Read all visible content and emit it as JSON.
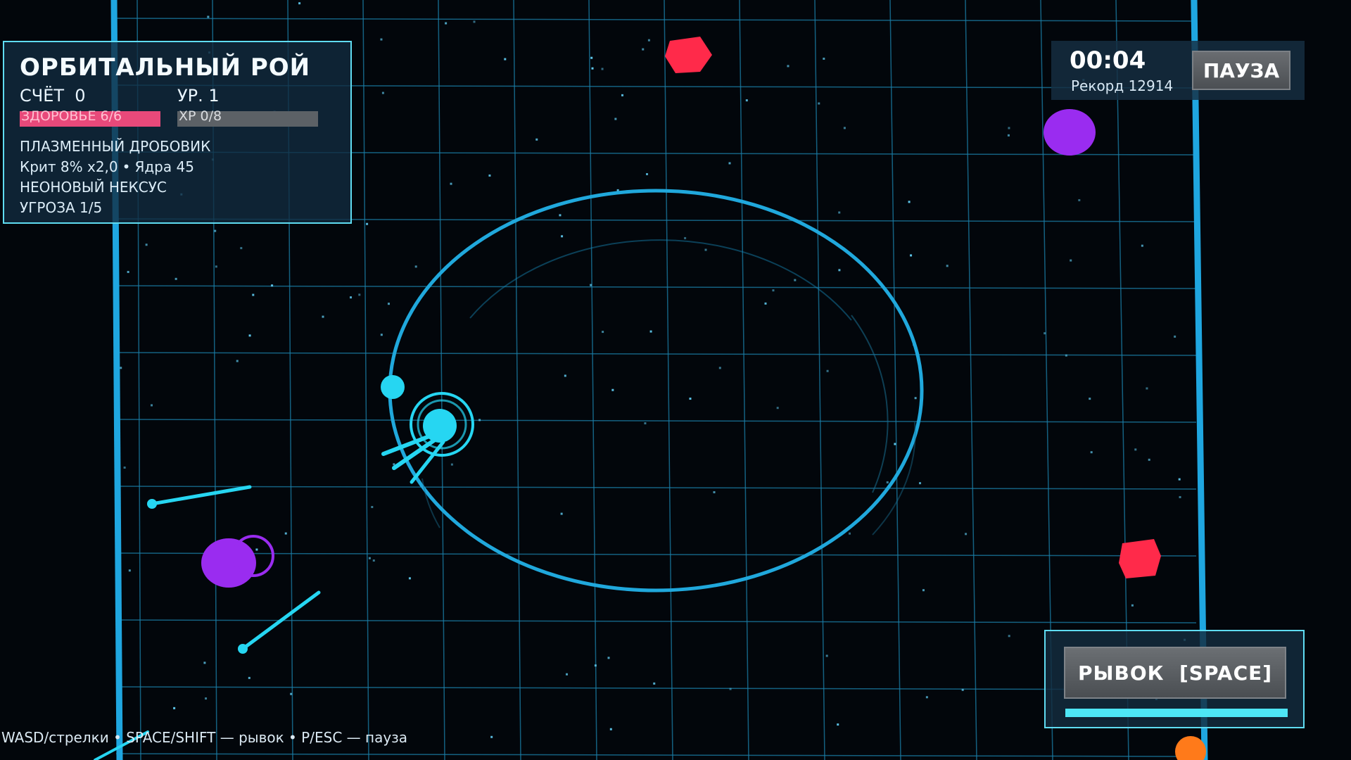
{
  "game": {
    "title": "ОРБИТАЛЬНЫЙ РОЙ",
    "score_label": "СЧЁТ  0",
    "level_label": "УР. 1",
    "health_label": "ЗДОРОВЬЕ 6/6",
    "health_fraction": 1.0,
    "xp_label": "XP 0/8",
    "xp_fraction": 0.0,
    "weapon": "ПЛАЗМЕННЫЙ ДРОБОВИК",
    "crit": "Крит 8% x2,0",
    "cores": "Ядра 45",
    "separator": "•",
    "nexus": "НЕОНОВЫЙ НЕКСУС",
    "threat": "УГРОЗА 1/5"
  },
  "timer": {
    "time": "00:04",
    "record": "Рекорд 12914",
    "pause_label": "ПАУЗА"
  },
  "dash": {
    "label": "РЫВОК  [SPACE]",
    "charge_fraction": 1.0
  },
  "controls_hint": "WASD/стрелки • SPACE/SHIFT — рывок • P/ESC — пауза",
  "colors": {
    "background": "#02060b",
    "grid": "#1b7fa8",
    "arena_border": "#1fa6e0",
    "player": "#26d6f2",
    "enemy_red": "#ff2a4a",
    "enemy_purple": "#9a2cf0",
    "enemy_orange": "#ff7a1a",
    "health": "#e8497a"
  },
  "entities": {
    "player": "player-ship",
    "orbiters": [
      "orbit-ring",
      "orbiting-core"
    ],
    "enemies": [
      "red-enemy",
      "red-enemy",
      "purple-enemy",
      "purple-enemy",
      "orange-enemy"
    ],
    "projectiles": [
      "plasma-bolt",
      "plasma-bolt",
      "plasma-bolt"
    ]
  }
}
